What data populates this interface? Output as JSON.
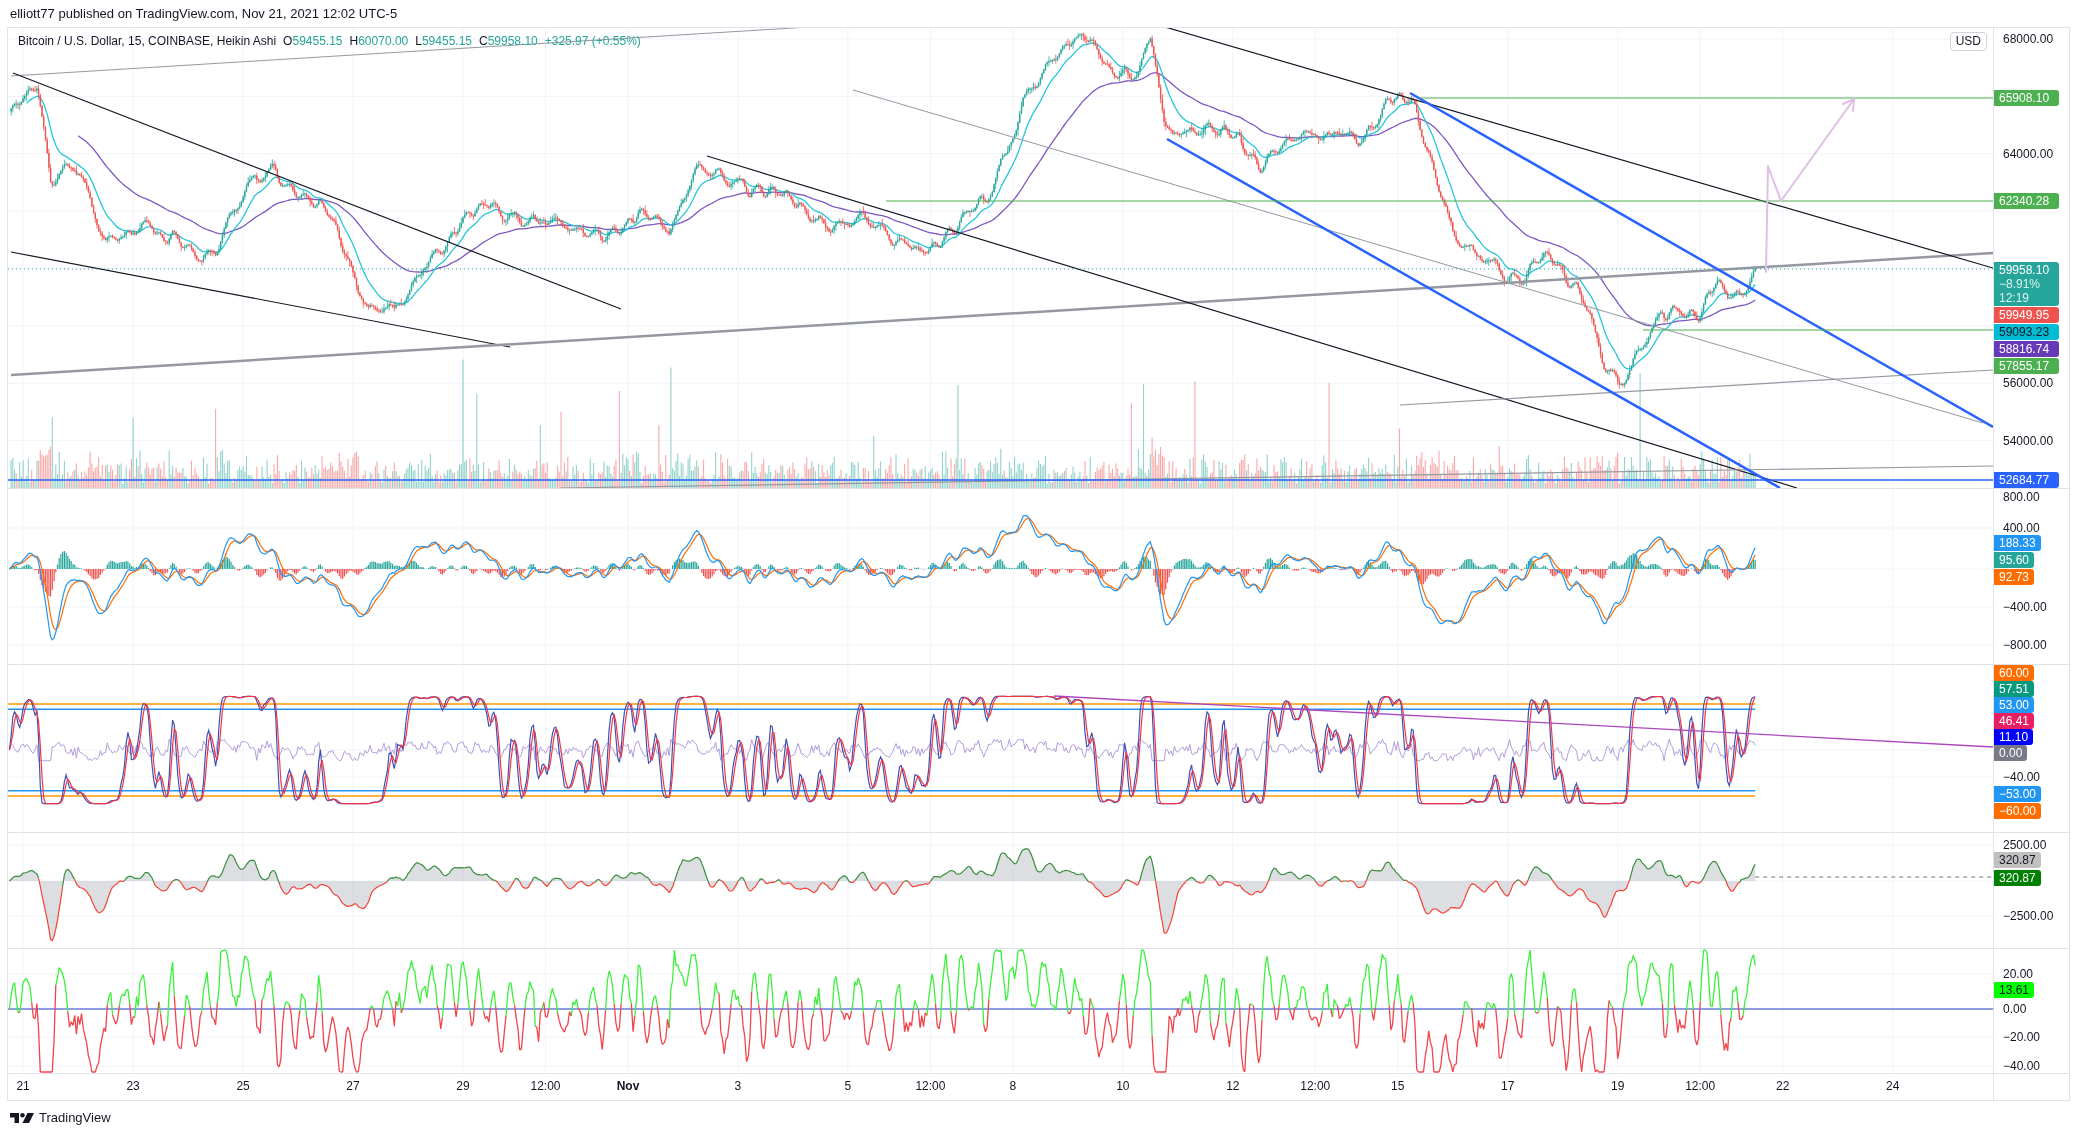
{
  "header": {
    "text": "elliott77 published on TradingView.com, Nov 21, 2021 12:02 UTC-5"
  },
  "legend": {
    "symbol": "Bitcoin / U.S. Dollar, 15, COINBASE, Heikin Ashi",
    "ohlc": [
      {
        "key": "O",
        "value": "59455.15"
      },
      {
        "key": "H",
        "value": "60070.00"
      },
      {
        "key": "L",
        "value": "59455.15"
      },
      {
        "key": "C",
        "value": "59958.10"
      }
    ],
    "change": "+325.97 (+0.55%)"
  },
  "price_pane": {
    "currency": "USD",
    "ticks": [
      "68000.00",
      "64000.00",
      "56000.00",
      "54000.00"
    ],
    "price_labels": [
      {
        "kind": "level",
        "text": "65908.10",
        "color": "#4caf50"
      },
      {
        "kind": "level",
        "text": "62340.28",
        "color": "#4caf50"
      },
      {
        "kind": "last",
        "lines": [
          "59958.10",
          "−8.91%",
          "12:19"
        ],
        "color": "#26a69a"
      },
      {
        "kind": "level",
        "text": "59949.95",
        "color": "#ef5350"
      },
      {
        "kind": "level",
        "text": "59093.23",
        "color": "#00bcd4"
      },
      {
        "kind": "level",
        "text": "58816.74",
        "color": "#673ab7"
      },
      {
        "kind": "level",
        "text": "57855.17",
        "color": "#4caf50"
      },
      {
        "kind": "level",
        "text": "52684.77",
        "color": "#2962ff"
      }
    ]
  },
  "indicator_panes": [
    {
      "ticks": [
        "800.00",
        "400.00",
        "−400.00",
        "−800.00"
      ],
      "labels": [
        {
          "text": "188.33",
          "color": "#2196f3"
        },
        {
          "text": "95.60",
          "color": "#26a69a"
        },
        {
          "text": "92.73",
          "color": "#ff6d00"
        }
      ]
    },
    {
      "ticks": [
        "−40.00"
      ],
      "labels": [
        {
          "text": "60.00",
          "color": "#ff6d00"
        },
        {
          "text": "57.51",
          "color": "#089981"
        },
        {
          "text": "53.00",
          "color": "#2196f3"
        },
        {
          "text": "46.41",
          "color": "#e91e63"
        },
        {
          "text": "11.10",
          "color": "#0000ff"
        },
        {
          "text": "0.00",
          "color": "#787b86"
        },
        {
          "text": "−53.00",
          "color": "#2196f3"
        },
        {
          "text": "−60.00",
          "color": "#ff6d00"
        }
      ]
    },
    {
      "ticks": [
        "2500.00",
        "−2500.00"
      ],
      "labels": [
        {
          "text": "320.87",
          "color": "#c0c0c0"
        },
        {
          "text": "320.87",
          "color": "#008000"
        }
      ]
    },
    {
      "ticks": [
        "20.00",
        "0.00",
        "−20.00",
        "−40.00"
      ],
      "labels": [
        {
          "text": "13.61",
          "color": "#00ff00"
        }
      ]
    }
  ],
  "time_axis": [
    {
      "label": "21",
      "kind": "day"
    },
    {
      "label": "23",
      "kind": "day"
    },
    {
      "label": "25",
      "kind": "day"
    },
    {
      "label": "27",
      "kind": "day"
    },
    {
      "label": "29",
      "kind": "day"
    },
    {
      "label": "12:00",
      "kind": "time"
    },
    {
      "label": "Nov",
      "kind": "month"
    },
    {
      "label": "3",
      "kind": "day"
    },
    {
      "label": "5",
      "kind": "day"
    },
    {
      "label": "12:00",
      "kind": "time"
    },
    {
      "label": "8",
      "kind": "day"
    },
    {
      "label": "10",
      "kind": "day"
    },
    {
      "label": "12",
      "kind": "day"
    },
    {
      "label": "12:00",
      "kind": "time"
    },
    {
      "label": "15",
      "kind": "day"
    },
    {
      "label": "17",
      "kind": "day"
    },
    {
      "label": "19",
      "kind": "day"
    },
    {
      "label": "12:00",
      "kind": "time"
    },
    {
      "label": "22",
      "kind": "day"
    },
    {
      "label": "24",
      "kind": "day"
    }
  ],
  "footer": {
    "brand": "TradingView"
  }
}
